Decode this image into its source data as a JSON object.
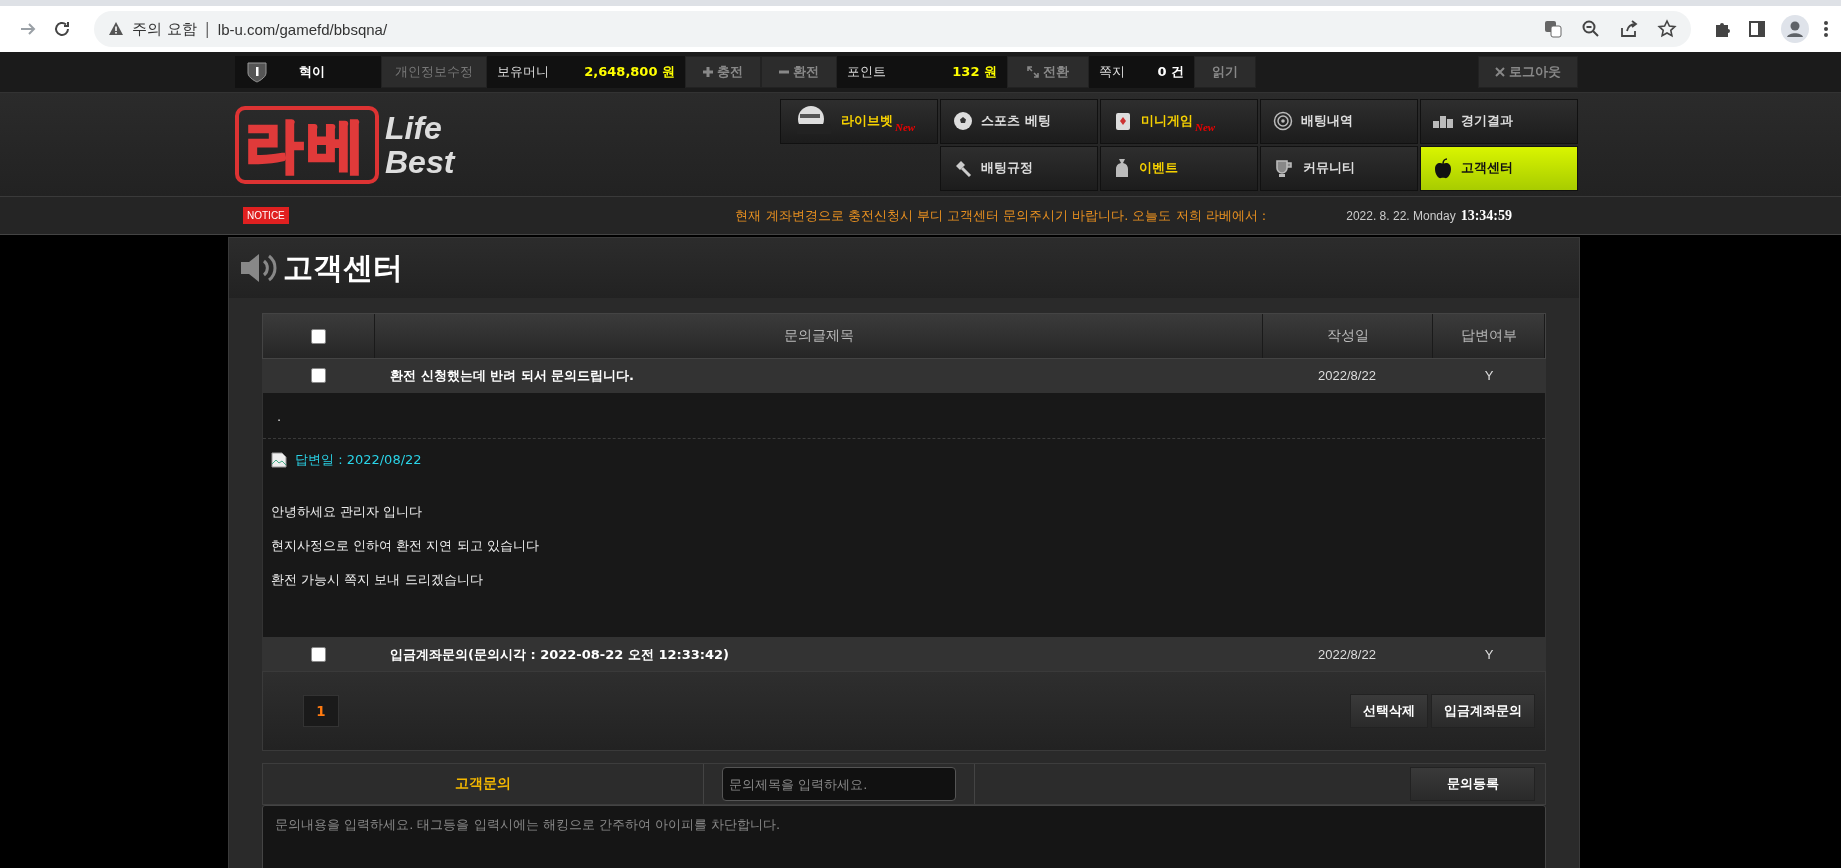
{
  "browser": {
    "warning": "주의 요함",
    "separator": "|",
    "url": "lb-u.com/gamefd/bbsqna/"
  },
  "member_bar": {
    "username": "혁이",
    "edit_profile": "개인정보수정",
    "money_label": "보유머니",
    "money_value": "2,648,800 원",
    "charge": "충전",
    "exchange": "환전",
    "point_label": "포인트",
    "point_value": "132 원",
    "convert": "전환",
    "memo_label": "쪽지",
    "memo_value": "0 건",
    "read": "읽기",
    "logout": "로그아웃"
  },
  "logo": {
    "korean": "라베",
    "english_top": "Life",
    "english_bottom": "Best"
  },
  "nav": {
    "rows": [
      [
        {
          "label": "라이브벳",
          "badge": "New",
          "highlight": true,
          "selected": false
        },
        {
          "label": "스포츠 베팅",
          "highlight": false,
          "selected": false
        },
        {
          "label": "미니게임",
          "badge": "New",
          "highlight": true,
          "selected": false
        },
        {
          "label": "배팅내역",
          "highlight": false,
          "selected": false
        },
        {
          "label": "경기결과",
          "highlight": false,
          "selected": false
        }
      ],
      [
        "",
        {
          "label": "배팅규정",
          "highlight": false,
          "selected": false
        },
        {
          "label": "이벤트",
          "highlight": true,
          "selected": false
        },
        {
          "label": "커뮤니티",
          "highlight": false,
          "selected": false
        },
        {
          "label": "고객센터",
          "highlight": false,
          "selected": true
        }
      ]
    ]
  },
  "notice": {
    "badge": "NOTICE",
    "text": "현재 계좌변경으로 충전신청시 부디 고객센터 문의주시기 바랍니다. 오늘도 저희 라베에서 :",
    "date": "2022. 8. 22. Monday",
    "time": "13:34:59"
  },
  "page_title": "고객센터",
  "table": {
    "select_all_checked": false,
    "columns": [
      "문의글제목",
      "작성일",
      "답변여부"
    ],
    "rows": [
      {
        "checked": false,
        "title": "환전 신청했는데 반려 되서 문의드립니다.",
        "date": "2022/8/22",
        "answered": "Y",
        "question": ".",
        "answer_date": "답변일 : 2022/08/22",
        "answer_lines": [
          "안녕하세요 관리자 입니다",
          "현지사정으로 인하여 환전 지연 되고 있습니다",
          "환전 가능시 쪽지 보내 드리겠습니다"
        ]
      },
      {
        "checked": false,
        "title": "입금계좌문의(문의시각 : 2022-08-22 오전 12:33:42)",
        "date": "2022/8/22",
        "answered": "Y"
      }
    ]
  },
  "pagination": [
    {
      "label": "1",
      "selected": true
    }
  ],
  "actions": [
    "선택삭제",
    "입금계좌문의"
  ],
  "form": {
    "label": "고객문의",
    "title_placeholder": "문의제목을 입력하세요.",
    "submit": "문의등록",
    "content_placeholder": "문의내용을 입력하세요. 태그등을 입력시에는 해킹으로 간주하여 아이피를 차단합니다."
  }
}
